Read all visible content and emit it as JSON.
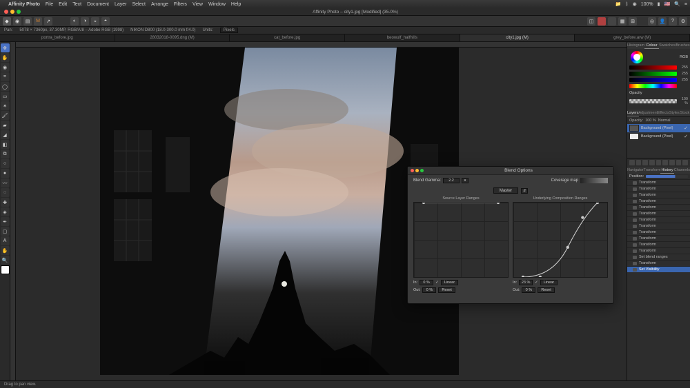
{
  "menu": {
    "items": [
      "File",
      "Edit",
      "Text",
      "Document",
      "Layer",
      "Select",
      "Arrange",
      "Filters",
      "View",
      "Window",
      "Help"
    ],
    "app": "Affinity Photo",
    "battery": "100%",
    "flag": "🇺🇸"
  },
  "window": {
    "title": "Affinity Photo – city1.jpg [Modified] (35.0%)"
  },
  "toolbar": {
    "personas": [
      "photo-persona",
      "liquify-persona",
      "develop-persona",
      "tone-mapping-persona",
      "export-persona"
    ]
  },
  "context": {
    "label": "Pan:",
    "info": "5078 × 7360px, 37.30MP, RGB/A/8 – Adobe RGB (1998)",
    "camera": "NIKON D800 (18.0-300.0 mm f/4.0)",
    "units_label": "Units:",
    "units_value": "Pixels"
  },
  "tabs": {
    "items": [
      "portra_before.jpg",
      "28032018-0095.dng (M)",
      "cat_before.jpg",
      "beowulf_halfhills",
      "city1.jpg (M)",
      "grey_before.arw (M)"
    ],
    "active": 4
  },
  "right": {
    "colour_tabs": [
      "Histogram",
      "Colour",
      "Swatches",
      "Brushes"
    ],
    "colour_active": 1,
    "colour_mode": "RGB",
    "rgb": {
      "r": 255,
      "g": 255,
      "b": 255
    },
    "opacity_label": "Opacity",
    "opacity_value": "100 %",
    "layer_tabs": [
      "Layers",
      "Adjustment",
      "Effects",
      "Styles",
      "Stock"
    ],
    "layer_active": 0,
    "layer_header": {
      "opacity": "100 %",
      "blend": "Normal"
    },
    "layers": [
      {
        "name": "Background (Pixel)",
        "selected": true,
        "visible": true
      },
      {
        "name": "Background (Pixel)",
        "selected": false,
        "visible": true
      }
    ],
    "lower_tabs": [
      "Navigator",
      "Transform",
      "History",
      "Channels"
    ],
    "lower_active": 2,
    "history_pos": "Position:",
    "history": [
      "Transform",
      "Transform",
      "Transform",
      "Transform",
      "Transform",
      "Transform",
      "Transform",
      "Transform",
      "Transform",
      "Transform",
      "Transform",
      "Transform",
      "Set blend ranges",
      "Transform",
      "Set Visibility"
    ],
    "history_sel": 14
  },
  "dialog": {
    "title": "Blend Options",
    "gamma_label": "Blend Gamma:",
    "gamma_value": "2.2",
    "coverage_label": "Coverage map",
    "master_label": "Master",
    "graphs": {
      "left": "Source Layer Ranges",
      "right": "Underlying Composition Ranges"
    },
    "under": {
      "in_label": "In:",
      "in_value": "23 %",
      "in_mode": "Linear",
      "out_label": "Out:",
      "out_value": "0 %",
      "reset": "Reset"
    },
    "source": {
      "in_label": "In:",
      "in_value": "0 %",
      "in_mode": "Linear",
      "out_label": "Out:",
      "out_value": "0 %",
      "reset": "Reset"
    }
  },
  "status": {
    "hint": "Drag to pan view."
  }
}
